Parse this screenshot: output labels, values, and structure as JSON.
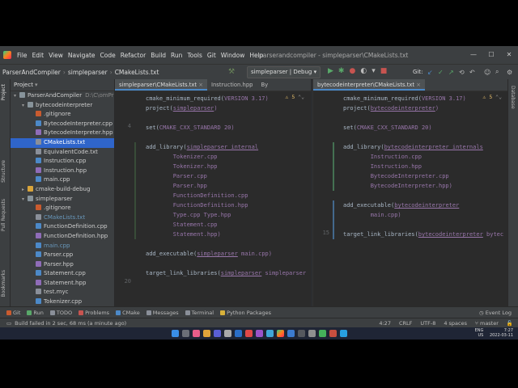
{
  "menubar": {
    "items": [
      "File",
      "Edit",
      "View",
      "Navigate",
      "Code",
      "Refactor",
      "Build",
      "Run",
      "Tools",
      "Git",
      "Window",
      "Help"
    ],
    "window_title": "parserandcompiler - simpleparser\\CMakeLists.txt"
  },
  "navbar": {
    "breadcrumbs": [
      "ParserAndCompiler",
      "simpleparser",
      "CMakeLists.txt"
    ],
    "run_config": "simpleparser | Debug",
    "git_label": "Git:"
  },
  "left_strip": {
    "project": "Project",
    "structure": "Structure",
    "pull_requests": "Pull Requests",
    "bookmarks": "Bookmarks"
  },
  "right_strip": {
    "database": "Database"
  },
  "project_panel": {
    "title": "Project",
    "tree": [
      {
        "label": "ParserAndCompiler",
        "suffix": "D:\\C\\omPr",
        "indent": 0,
        "icon": "folder",
        "arrow": "▾"
      },
      {
        "label": "bytecodeinterpreter",
        "indent": 1,
        "icon": "folder",
        "arrow": "▾"
      },
      {
        "label": ".gitignore",
        "indent": 2,
        "icon": "git"
      },
      {
        "label": "BytecodeInterpreter.cpp",
        "indent": 2,
        "icon": "cpp"
      },
      {
        "label": "BytecodeInterpreter.hpp",
        "indent": 2,
        "icon": "h"
      },
      {
        "label": "CMakeLists.txt",
        "indent": 2,
        "icon": "txt",
        "selected": true
      },
      {
        "label": "EquivalentCode.txt",
        "indent": 2,
        "icon": "txt"
      },
      {
        "label": "Instruction.cpp",
        "indent": 2,
        "icon": "cpp"
      },
      {
        "label": "Instruction.hpp",
        "indent": 2,
        "icon": "h"
      },
      {
        "label": "main.cpp",
        "indent": 2,
        "icon": "cpp"
      },
      {
        "label": "cmake-build-debug",
        "indent": 1,
        "icon": "yellow",
        "arrow": "▸"
      },
      {
        "label": "simpleparser",
        "indent": 1,
        "icon": "folder",
        "arrow": "▾"
      },
      {
        "label": ".gitignore",
        "indent": 2,
        "icon": "git"
      },
      {
        "label": "CMakeLists.txt",
        "indent": 2,
        "icon": "txt",
        "blue": true
      },
      {
        "label": "FunctionDefinition.cpp",
        "indent": 2,
        "icon": "cpp"
      },
      {
        "label": "FunctionDefinition.hpp",
        "indent": 2,
        "icon": "h"
      },
      {
        "label": "main.cpp",
        "indent": 2,
        "icon": "cpp",
        "blue": true
      },
      {
        "label": "Parser.cpp",
        "indent": 2,
        "icon": "cpp"
      },
      {
        "label": "Parser.hpp",
        "indent": 2,
        "icon": "h"
      },
      {
        "label": "Statement.cpp",
        "indent": 2,
        "icon": "cpp"
      },
      {
        "label": "Statement.hpp",
        "indent": 2,
        "icon": "h"
      },
      {
        "label": "test.myc",
        "indent": 2,
        "icon": "txt"
      },
      {
        "label": "Tokenizer.cpp",
        "indent": 2,
        "icon": "cpp"
      }
    ]
  },
  "left_editor": {
    "tabs": [
      "simpleparser\\CMakeLists.txt",
      "Instruction.hpp",
      "By"
    ],
    "warning_count": "5",
    "line_numbers": [
      "",
      "",
      "",
      "4",
      "",
      "",
      "",
      "",
      "",
      "",
      "",
      "",
      "",
      "",
      "",
      "",
      "",
      "",
      "",
      "20"
    ],
    "lines": [
      {
        "t": "cmake_minimum_required(VERSION 3.17)"
      },
      {
        "t": "project(simpleparser)"
      },
      {
        "t": ""
      },
      {
        "t": "set(CMAKE_CXX_STANDARD 20)"
      },
      {
        "t": ""
      },
      {
        "t": "add_library(simpleparser_internal"
      },
      {
        "t": "        Tokenizer.cpp"
      },
      {
        "t": "        Tokenizer.hpp"
      },
      {
        "t": "        Parser.cpp"
      },
      {
        "t": "        Parser.hpp"
      },
      {
        "t": "        FunctionDefinition.cpp"
      },
      {
        "t": "        FunctionDefinition.hpp"
      },
      {
        "t": "        Type.cpp Type.hpp"
      },
      {
        "t": "        Statement.cpp"
      },
      {
        "t": "        Statement.hpp)"
      },
      {
        "t": ""
      },
      {
        "t": "add_executable(simpleparser main.cpp)"
      },
      {
        "t": ""
      },
      {
        "t": "target_link_libraries(simpleparser simpleparser"
      },
      {
        "t": ""
      }
    ]
  },
  "right_editor": {
    "tabs": [
      "bytecodeinterpreter\\CMakeLists.txt"
    ],
    "warning_count": "5",
    "line_numbers": [
      "",
      "",
      "",
      "",
      "",
      "",
      "",
      "",
      "",
      "",
      "",
      "",
      "",
      "",
      "15"
    ],
    "lines": [
      {
        "t": "cmake_minimum_required(VERSION 3.17)"
      },
      {
        "t": "project(bytecodeinterpreter)"
      },
      {
        "t": ""
      },
      {
        "t": "set(CMAKE_CXX_STANDARD 20)"
      },
      {
        "t": ""
      },
      {
        "t": "add_library(bytecodeinterpreter_internals"
      },
      {
        "t": "        Instruction.cpp"
      },
      {
        "t": "        Instruction.hpp"
      },
      {
        "t": "        BytecodeInterpreter.cpp"
      },
      {
        "t": "        BytecodeInterpreter.hpp)"
      },
      {
        "t": ""
      },
      {
        "t": "add_executable(bytecodeinterpreter"
      },
      {
        "t": "        main.cpp)"
      },
      {
        "t": ""
      },
      {
        "t": "target_link_libraries(bytecodeinterpreter bytec"
      }
    ]
  },
  "tool_windows": [
    "Git",
    "Run",
    "TODO",
    "Problems",
    "CMake",
    "Messages",
    "Terminal",
    "Python Packages"
  ],
  "event_log": "Event Log",
  "status": {
    "message": "Build failed in 2 sec, 68 ms (a minute ago)",
    "position": "4:27",
    "line_sep": "CRLF",
    "encoding": "UTF-8",
    "indent": "4 spaces",
    "branch": "master"
  },
  "tray": {
    "lang": "ENG\nUS",
    "time": "7:27\n2022-03-11"
  }
}
